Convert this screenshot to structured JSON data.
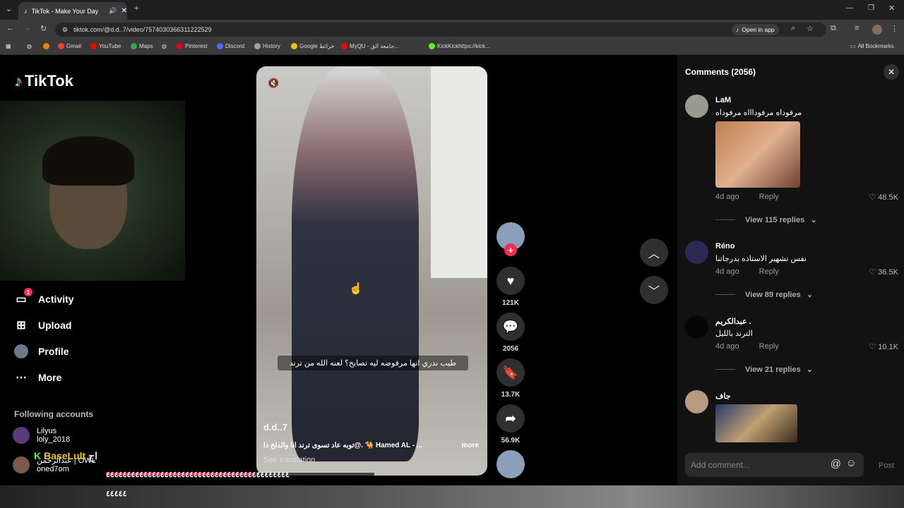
{
  "browser": {
    "tab_title": "TikTok - Make Your Day",
    "new_tab": "+",
    "url": "tiktok.com/@d.d..7/video/7574030366311222529",
    "open_in_app": "Open in app",
    "bookmarks": [
      {
        "label": "Gmail",
        "color": "#ea4335"
      },
      {
        "label": "YouTube",
        "color": "#ff0000"
      },
      {
        "label": "Maps",
        "color": "#34a853"
      },
      {
        "label": "Pinterest",
        "color": "#e60023"
      },
      {
        "label": "Discord",
        "color": "#5865f2"
      },
      {
        "label": "History",
        "color": "#9aa0a6"
      },
      {
        "label": "Google خرائط",
        "color": "#fbbc04"
      },
      {
        "label": "MyQU - جامعة الق...",
        "color": "#ff0000"
      },
      {
        "label": "KickKickhttps://kick...",
        "color": "#53fc18"
      }
    ],
    "all_bookmarks": "All Bookmarks"
  },
  "sidebar": {
    "logo": "TikTok",
    "nav": [
      {
        "label": "Activity",
        "icon": "inbox-icon",
        "badge": "1"
      },
      {
        "label": "Upload",
        "icon": "plus-square-icon"
      },
      {
        "label": "Profile",
        "icon": "avatar-icon"
      },
      {
        "label": "More",
        "icon": "more-icon"
      }
    ],
    "following_title": "Following accounts",
    "accounts": [
      {
        "name": "Lilyus",
        "handle": "loly_2018"
      },
      {
        "name": "عبدالرحمن | OWL",
        "handle": "oned7om"
      }
    ]
  },
  "video": {
    "caption": "طيب ندري انها مرفوضه ليه تصايح؟ لعنه الله من ترند",
    "author": "d.d..7",
    "description": "توبه عاد تسوى ترند انا والدلخ دا@. 🐪 Hamed AL - ...",
    "more": "more",
    "see_translation": "See translation",
    "progress": 0.55
  },
  "actions": {
    "likes": "121K",
    "comments": "2056",
    "saves": "13.7K",
    "shares": "56.9K"
  },
  "comments": {
    "title": "Comments (2056)",
    "items": [
      {
        "name": "LaM",
        "text": "مرفوداه مرفوداااه مرفوداه",
        "time": "4d ago",
        "reply": "Reply",
        "likes": "48.5K",
        "view_replies": "View 115 replies"
      },
      {
        "name": "Réno",
        "text": "نفس تشهير الاستاذه بدرجاتنا",
        "time": "4d ago",
        "reply": "Reply",
        "likes": "36.5K",
        "view_replies": "View 89 replies"
      },
      {
        "name": "عبدالكريم .",
        "text": "الترند بالليل",
        "time": "4d ago",
        "reply": "Reply",
        "likes": "10.1K",
        "view_replies": "View 21 replies"
      },
      {
        "name": "جاف",
        "text": "",
        "time": "",
        "reply": "",
        "likes": "",
        "view_replies": ""
      }
    ],
    "add_placeholder": "Add comment...",
    "post": "Post"
  },
  "overlay": {
    "streamer": "BaseLult",
    "junk_line1": "٤٤٤٤٤٤٤٤٤٤٤٤٤٤٤٤٤٤٤٤٤٤٤٤٤٤٤٤٤٤٤٤٤٤٤٤٤٤٤٤٤٤٤٤",
    "junk_line2": "٤٤٤٤٤",
    "ah": "اح"
  }
}
